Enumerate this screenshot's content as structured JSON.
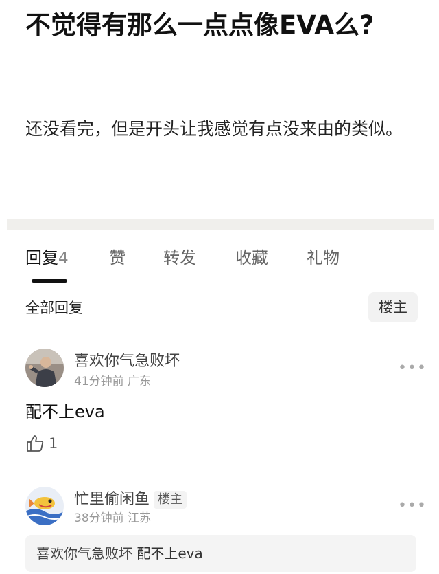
{
  "post": {
    "title": "不觉得有那么一点点像EVA么?",
    "body": "还没看完，但是开头让我感觉有点没来由的类似。"
  },
  "tabs": [
    {
      "label": "回复",
      "count": "4"
    },
    {
      "label": "赞"
    },
    {
      "label": "转发"
    },
    {
      "label": "收藏"
    },
    {
      "label": "礼物"
    }
  ],
  "replies_header": {
    "label": "全部回复",
    "owner_button": "楼主"
  },
  "comments": [
    {
      "username": "喜欢你气急败坏",
      "time": "41分钟前",
      "location": "广东",
      "text": "配不上eva",
      "likes": "1",
      "more_icon": "more-dots-icon"
    },
    {
      "username": "忙里偷闲鱼",
      "badge": "楼主",
      "time": "38分钟前",
      "location": "江苏",
      "quote_name": "喜欢你气急败坏",
      "quote_text": "配不上eva",
      "more_icon": "more-dots-icon"
    }
  ],
  "colors": {
    "divider_band": "#f0efec",
    "active_tab_underline": "#111111"
  }
}
